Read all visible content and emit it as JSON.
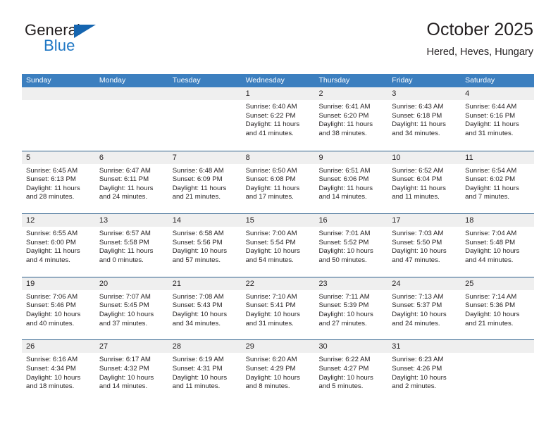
{
  "brand": {
    "name_top": "General",
    "name_bottom": "Blue",
    "triangle_color": "#1565b0",
    "blue_text_color": "#1f77c4"
  },
  "header": {
    "title": "October 2025",
    "location": "Hered, Heves, Hungary"
  },
  "theme": {
    "weekday_header_bg": "#3c7fbf",
    "weekday_header_text": "#ffffff",
    "week_divider": "#2d5f8b",
    "daynum_bg": "#efefef",
    "text": "#231f20"
  },
  "weekdays": [
    "Sunday",
    "Monday",
    "Tuesday",
    "Wednesday",
    "Thursday",
    "Friday",
    "Saturday"
  ],
  "weeks": [
    [
      {
        "empty": true
      },
      {
        "empty": true
      },
      {
        "empty": true
      },
      {
        "day": "1",
        "sunrise": "Sunrise: 6:40 AM",
        "sunset": "Sunset: 6:22 PM",
        "daylight_1": "Daylight: 11 hours",
        "daylight_2": "and 41 minutes."
      },
      {
        "day": "2",
        "sunrise": "Sunrise: 6:41 AM",
        "sunset": "Sunset: 6:20 PM",
        "daylight_1": "Daylight: 11 hours",
        "daylight_2": "and 38 minutes."
      },
      {
        "day": "3",
        "sunrise": "Sunrise: 6:43 AM",
        "sunset": "Sunset: 6:18 PM",
        "daylight_1": "Daylight: 11 hours",
        "daylight_2": "and 34 minutes."
      },
      {
        "day": "4",
        "sunrise": "Sunrise: 6:44 AM",
        "sunset": "Sunset: 6:16 PM",
        "daylight_1": "Daylight: 11 hours",
        "daylight_2": "and 31 minutes."
      }
    ],
    [
      {
        "day": "5",
        "sunrise": "Sunrise: 6:45 AM",
        "sunset": "Sunset: 6:13 PM",
        "daylight_1": "Daylight: 11 hours",
        "daylight_2": "and 28 minutes."
      },
      {
        "day": "6",
        "sunrise": "Sunrise: 6:47 AM",
        "sunset": "Sunset: 6:11 PM",
        "daylight_1": "Daylight: 11 hours",
        "daylight_2": "and 24 minutes."
      },
      {
        "day": "7",
        "sunrise": "Sunrise: 6:48 AM",
        "sunset": "Sunset: 6:09 PM",
        "daylight_1": "Daylight: 11 hours",
        "daylight_2": "and 21 minutes."
      },
      {
        "day": "8",
        "sunrise": "Sunrise: 6:50 AM",
        "sunset": "Sunset: 6:08 PM",
        "daylight_1": "Daylight: 11 hours",
        "daylight_2": "and 17 minutes."
      },
      {
        "day": "9",
        "sunrise": "Sunrise: 6:51 AM",
        "sunset": "Sunset: 6:06 PM",
        "daylight_1": "Daylight: 11 hours",
        "daylight_2": "and 14 minutes."
      },
      {
        "day": "10",
        "sunrise": "Sunrise: 6:52 AM",
        "sunset": "Sunset: 6:04 PM",
        "daylight_1": "Daylight: 11 hours",
        "daylight_2": "and 11 minutes."
      },
      {
        "day": "11",
        "sunrise": "Sunrise: 6:54 AM",
        "sunset": "Sunset: 6:02 PM",
        "daylight_1": "Daylight: 11 hours",
        "daylight_2": "and 7 minutes."
      }
    ],
    [
      {
        "day": "12",
        "sunrise": "Sunrise: 6:55 AM",
        "sunset": "Sunset: 6:00 PM",
        "daylight_1": "Daylight: 11 hours",
        "daylight_2": "and 4 minutes."
      },
      {
        "day": "13",
        "sunrise": "Sunrise: 6:57 AM",
        "sunset": "Sunset: 5:58 PM",
        "daylight_1": "Daylight: 11 hours",
        "daylight_2": "and 0 minutes."
      },
      {
        "day": "14",
        "sunrise": "Sunrise: 6:58 AM",
        "sunset": "Sunset: 5:56 PM",
        "daylight_1": "Daylight: 10 hours",
        "daylight_2": "and 57 minutes."
      },
      {
        "day": "15",
        "sunrise": "Sunrise: 7:00 AM",
        "sunset": "Sunset: 5:54 PM",
        "daylight_1": "Daylight: 10 hours",
        "daylight_2": "and 54 minutes."
      },
      {
        "day": "16",
        "sunrise": "Sunrise: 7:01 AM",
        "sunset": "Sunset: 5:52 PM",
        "daylight_1": "Daylight: 10 hours",
        "daylight_2": "and 50 minutes."
      },
      {
        "day": "17",
        "sunrise": "Sunrise: 7:03 AM",
        "sunset": "Sunset: 5:50 PM",
        "daylight_1": "Daylight: 10 hours",
        "daylight_2": "and 47 minutes."
      },
      {
        "day": "18",
        "sunrise": "Sunrise: 7:04 AM",
        "sunset": "Sunset: 5:48 PM",
        "daylight_1": "Daylight: 10 hours",
        "daylight_2": "and 44 minutes."
      }
    ],
    [
      {
        "day": "19",
        "sunrise": "Sunrise: 7:06 AM",
        "sunset": "Sunset: 5:46 PM",
        "daylight_1": "Daylight: 10 hours",
        "daylight_2": "and 40 minutes."
      },
      {
        "day": "20",
        "sunrise": "Sunrise: 7:07 AM",
        "sunset": "Sunset: 5:45 PM",
        "daylight_1": "Daylight: 10 hours",
        "daylight_2": "and 37 minutes."
      },
      {
        "day": "21",
        "sunrise": "Sunrise: 7:08 AM",
        "sunset": "Sunset: 5:43 PM",
        "daylight_1": "Daylight: 10 hours",
        "daylight_2": "and 34 minutes."
      },
      {
        "day": "22",
        "sunrise": "Sunrise: 7:10 AM",
        "sunset": "Sunset: 5:41 PM",
        "daylight_1": "Daylight: 10 hours",
        "daylight_2": "and 31 minutes."
      },
      {
        "day": "23",
        "sunrise": "Sunrise: 7:11 AM",
        "sunset": "Sunset: 5:39 PM",
        "daylight_1": "Daylight: 10 hours",
        "daylight_2": "and 27 minutes."
      },
      {
        "day": "24",
        "sunrise": "Sunrise: 7:13 AM",
        "sunset": "Sunset: 5:37 PM",
        "daylight_1": "Daylight: 10 hours",
        "daylight_2": "and 24 minutes."
      },
      {
        "day": "25",
        "sunrise": "Sunrise: 7:14 AM",
        "sunset": "Sunset: 5:36 PM",
        "daylight_1": "Daylight: 10 hours",
        "daylight_2": "and 21 minutes."
      }
    ],
    [
      {
        "day": "26",
        "sunrise": "Sunrise: 6:16 AM",
        "sunset": "Sunset: 4:34 PM",
        "daylight_1": "Daylight: 10 hours",
        "daylight_2": "and 18 minutes."
      },
      {
        "day": "27",
        "sunrise": "Sunrise: 6:17 AM",
        "sunset": "Sunset: 4:32 PM",
        "daylight_1": "Daylight: 10 hours",
        "daylight_2": "and 14 minutes."
      },
      {
        "day": "28",
        "sunrise": "Sunrise: 6:19 AM",
        "sunset": "Sunset: 4:31 PM",
        "daylight_1": "Daylight: 10 hours",
        "daylight_2": "and 11 minutes."
      },
      {
        "day": "29",
        "sunrise": "Sunrise: 6:20 AM",
        "sunset": "Sunset: 4:29 PM",
        "daylight_1": "Daylight: 10 hours",
        "daylight_2": "and 8 minutes."
      },
      {
        "day": "30",
        "sunrise": "Sunrise: 6:22 AM",
        "sunset": "Sunset: 4:27 PM",
        "daylight_1": "Daylight: 10 hours",
        "daylight_2": "and 5 minutes."
      },
      {
        "day": "31",
        "sunrise": "Sunrise: 6:23 AM",
        "sunset": "Sunset: 4:26 PM",
        "daylight_1": "Daylight: 10 hours",
        "daylight_2": "and 2 minutes."
      },
      {
        "empty": true
      }
    ]
  ]
}
